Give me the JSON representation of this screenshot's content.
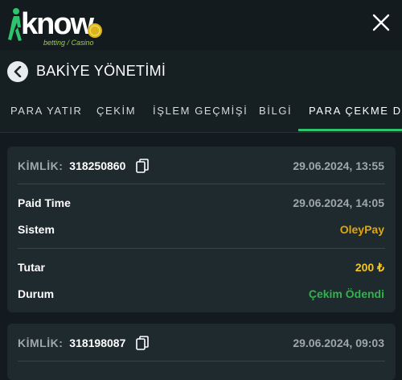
{
  "brand": {
    "logo_text": "know",
    "logo_subtitle": "betting / Casino",
    "accent": "#2ec36d"
  },
  "header": {
    "title": "BAKİYE YÖNETİMİ",
    "back_icon": "chevron-left-icon",
    "close_icon": "close-icon"
  },
  "tabs": [
    {
      "label": "PARA YATIR"
    },
    {
      "label": "ÇEKİM"
    },
    {
      "label": "İŞLEM GEÇMİŞİ"
    },
    {
      "label": "BİLGİ"
    },
    {
      "label": "PARA ÇEKME DU",
      "active": true
    }
  ],
  "transactions": [
    {
      "id_label": "KİMLİK:",
      "id": "318250860",
      "date": "29.06.2024, 13:55",
      "rows": [
        {
          "label": "Paid Time",
          "value": "29.06.2024, 14:05",
          "color": "#9ea7ab"
        },
        {
          "label": "Sistem",
          "value": "OleyPay",
          "color": "#e0a50e"
        },
        {
          "label": "Tutar",
          "value": "200 ₺",
          "color": "#f5c518"
        },
        {
          "label": "Durum",
          "value": "Çekim Ödendi",
          "color": "#2fb34a"
        }
      ]
    },
    {
      "id_label": "KİMLİK:",
      "id": "318198087",
      "date": "29.06.2024, 09:03"
    }
  ]
}
